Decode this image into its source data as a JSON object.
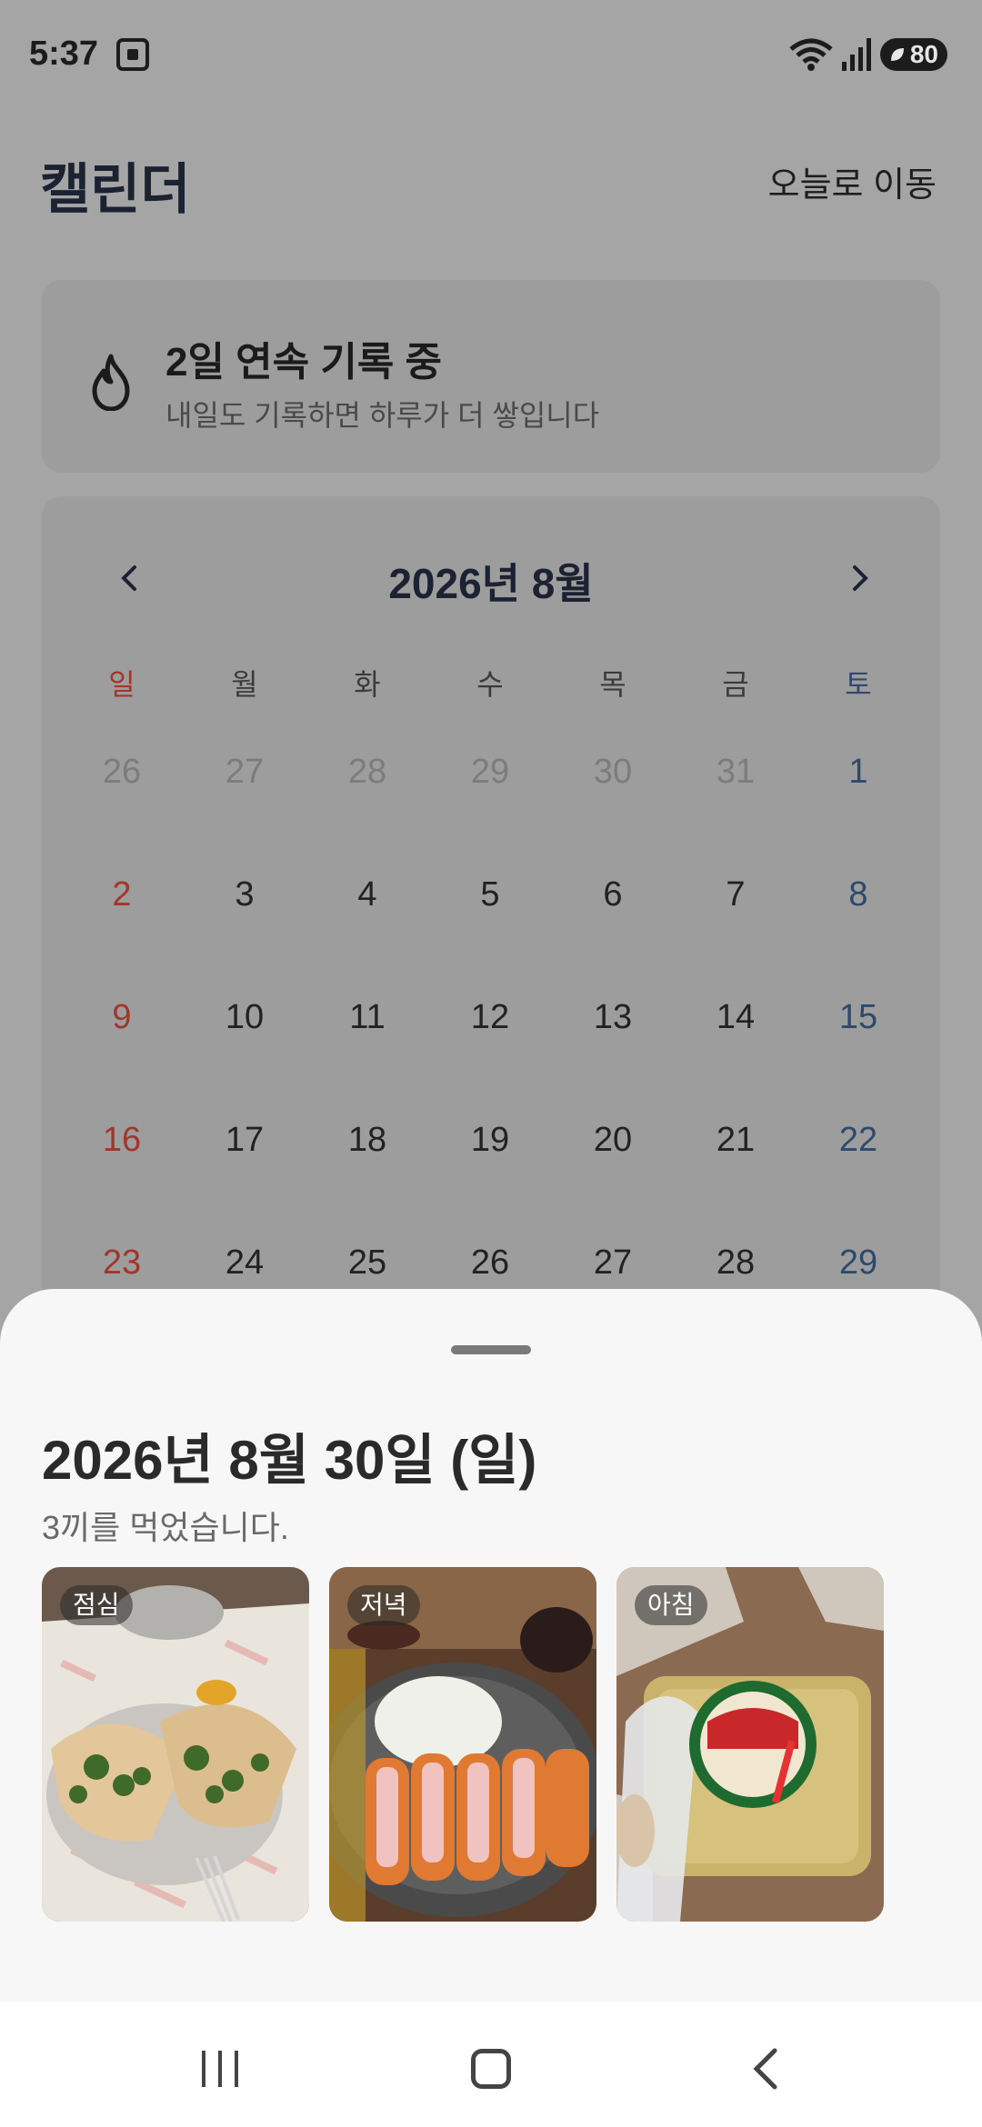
{
  "status": {
    "time": "5:37",
    "battery": "80"
  },
  "header": {
    "title": "캘린더",
    "today_link": "오늘로 이동"
  },
  "streak": {
    "title": "2일 연속 기록 중",
    "subtitle": "내일도 기록하면 하루가 더 쌓입니다"
  },
  "calendar": {
    "month": "2026년 8월",
    "weekdays": [
      "일",
      "월",
      "화",
      "수",
      "목",
      "금",
      "토"
    ],
    "weeks": [
      [
        "26",
        "27",
        "28",
        "29",
        "30",
        "31",
        "1"
      ],
      [
        "2",
        "3",
        "4",
        "5",
        "6",
        "7",
        "8"
      ],
      [
        "9",
        "10",
        "11",
        "12",
        "13",
        "14",
        "15"
      ],
      [
        "16",
        "17",
        "18",
        "19",
        "20",
        "21",
        "22"
      ],
      [
        "23",
        "24",
        "25",
        "26",
        "27",
        "28",
        "29"
      ]
    ]
  },
  "sheet": {
    "date": "2026년 8월 30일 (일)",
    "subtitle": "3끼를 먹었습니다.",
    "meals": [
      {
        "tag": "점심"
      },
      {
        "tag": "저녁"
      },
      {
        "tag": "아침"
      }
    ]
  }
}
